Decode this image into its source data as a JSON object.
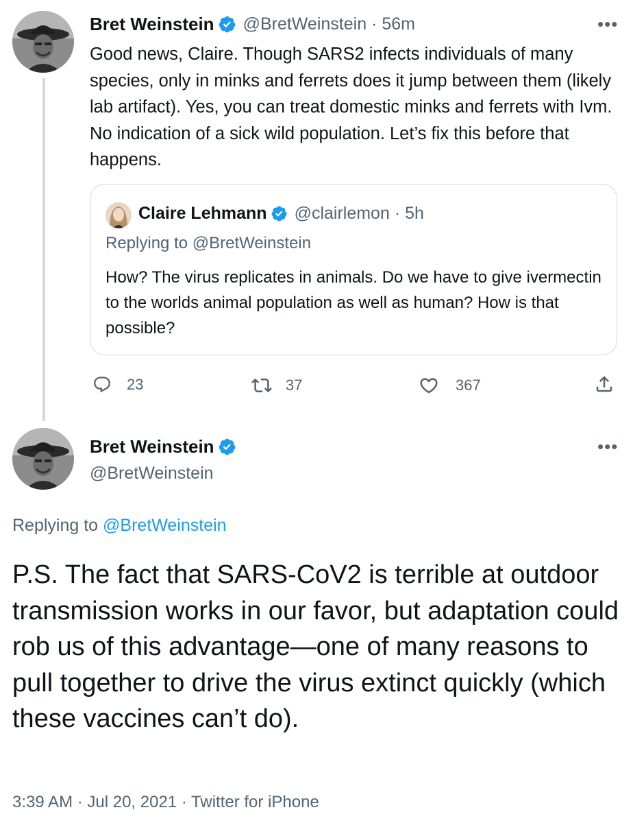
{
  "tweet1": {
    "author_name": "Bret Weinstein",
    "handle_time": "@BretWeinstein · 56m",
    "text": "Good news, Claire. Though SARS2 infects individuals of many species, only in minks and ferrets does it jump between them (likely lab artifact). Yes, you can treat domestic minks and ferrets with Ivm. No indication of a sick wild population. Let’s fix this before that happens.",
    "more_icon": "more-dots-icon",
    "quote": {
      "author_name": "Claire Lehmann",
      "handle_time": "@clairlemon · 5h",
      "replying_to": "Replying to @BretWeinstein",
      "text": "How? The virus replicates in animals. Do we have to give ivermectin to the worlds animal population as well as human? How is that possible?"
    },
    "actions": {
      "reply_count": "23",
      "retweet_count": "37",
      "like_count": "367"
    }
  },
  "tweet2": {
    "author_name": "Bret Weinstein",
    "handle": "@BretWeinstein",
    "replying_label": "Replying to",
    "replying_mention": "@BretWeinstein",
    "text": "P.S. The fact that SARS-CoV2 is terrible at outdoor transmission works in our favor, but adaptation could rob us of this advantage—one of many reasons to pull together to drive the virus extinct quickly (which these vaccines can’t do).",
    "meta": "3:39 AM · Jul 20, 2021 · Twitter for iPhone"
  },
  "colors": {
    "text": "#0f1419",
    "secondary": "#536471",
    "accent": "#1d9bf0",
    "border": "#cfd9de"
  }
}
